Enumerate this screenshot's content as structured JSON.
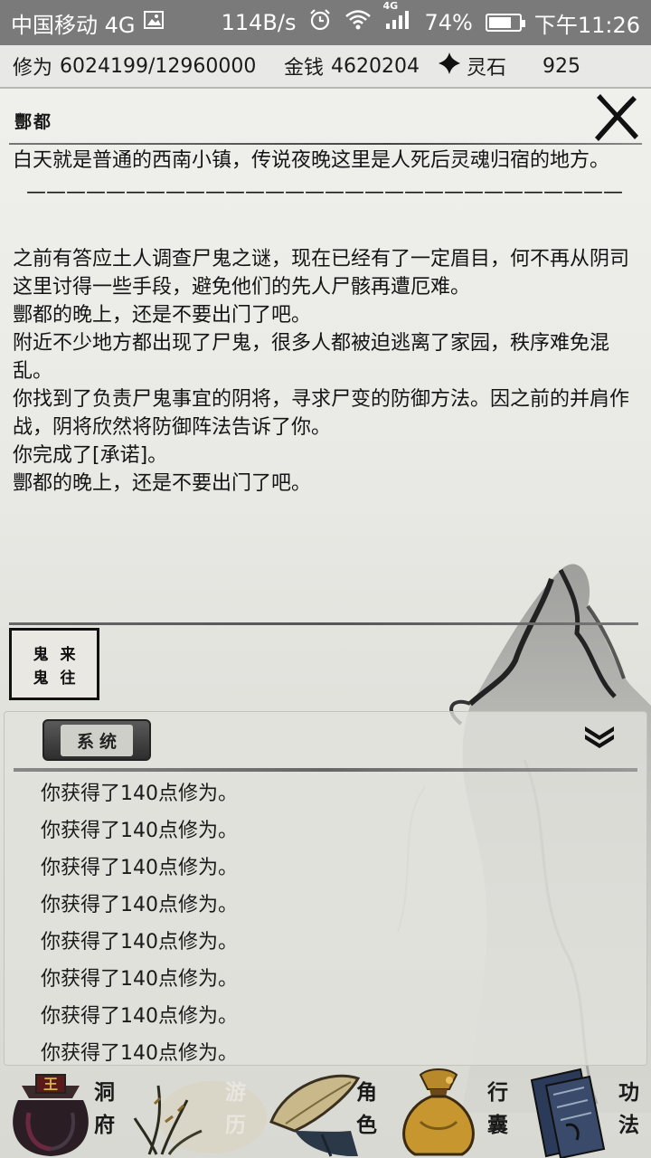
{
  "status_bar": {
    "carrier": "中国移动 4G",
    "speed": "114B/s",
    "network": "4G",
    "battery_pct": "74%",
    "battery_level": 0.74,
    "time": "下午11:26"
  },
  "resources": {
    "cultivation_label": "修为",
    "cultivation_value": "6024199/12960000",
    "money_label": "金钱",
    "money_value": "4620204",
    "stone_label": "灵石",
    "stone_value": "925"
  },
  "location": {
    "title": "酆都",
    "description_1": "白天就是普通的西南小镇，传说夜晚这里是人死后灵魂归宿的地方。",
    "divider": "——————————————————————————————",
    "events": [
      "之前有答应土人调查尸鬼之谜，现在已经有了一定眉目，何不再从阴司这里讨得一些手段，避免他们的先人尸骸再遭厄难。",
      "酆都的晚上，还是不要出门了吧。",
      "附近不少地方都出现了尸鬼，很多人都被迫逃离了家园，秩序难免混乱。",
      "你找到了负责尸鬼事宜的阴将，寻求尸变的防御方法。因之前的并肩作战，阴将欣然将防御阵法告诉了你。",
      "你完成了[承诺]。",
      "酆都的晚上，还是不要出门了吧。"
    ]
  },
  "action_button": {
    "chars": [
      "鬼",
      "来",
      "鬼",
      "往"
    ]
  },
  "log": {
    "tab_label": "系统",
    "lines": [
      "你获得了140点修为。",
      "你获得了140点修为。",
      "你获得了140点修为。",
      "你获得了140点修为。",
      "你获得了140点修为。",
      "你获得了140点修为。",
      "你获得了140点修为。",
      "你获得了140点修为。"
    ]
  },
  "nav": {
    "dongfu": [
      "洞",
      "府"
    ],
    "youli": [
      "游",
      "历"
    ],
    "juese": [
      "角",
      "色"
    ],
    "xingnang": [
      "行",
      "囊"
    ],
    "gongfa": [
      "功",
      "法"
    ]
  },
  "nav_icon_text": {
    "dongfu_badge": "王"
  },
  "colors": {
    "status_bar": "#7a7a7a",
    "ink": "#1a1a1a",
    "paper": "#ebebe7"
  }
}
